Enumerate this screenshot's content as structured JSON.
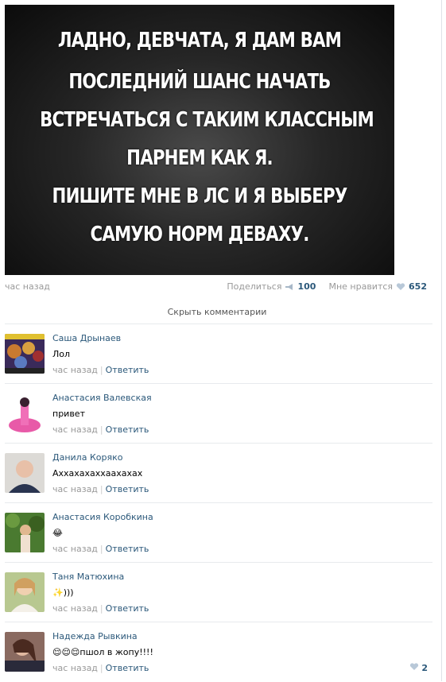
{
  "post": {
    "image_lines": [
      "ЛАДНО, ДЕВЧАТА, Я ДАМ ВАМ",
      "ПОСЛЕДНИЙ ШАНС НАЧАТЬ",
      "ВСТРЕЧАТЬСЯ С ТАКИМ КЛАССНЫМ",
      "ПАРНЕМ КАК Я.",
      "ПИШИТЕ МНЕ В ЛС И Я ВЫБЕРУ",
      "САМУЮ НОРМ ДЕВАХУ."
    ],
    "time": "час назад",
    "share_label": "Поделиться",
    "share_count": "100",
    "like_label": "Мне нравится",
    "like_count": "652",
    "hide_comments": "Скрыть комментарии"
  },
  "comments": [
    {
      "author": "Саша Дрынаев",
      "text": "Лол",
      "time": "час назад",
      "reply": "Ответить",
      "likes": ""
    },
    {
      "author": "Анастасия Валевская",
      "text": "привет",
      "time": "час назад",
      "reply": "Ответить",
      "likes": ""
    },
    {
      "author": "Данила Коряко",
      "text": "Аххахахаххаахахах",
      "time": "час назад",
      "reply": "Ответить",
      "likes": ""
    },
    {
      "author": "Анастасия Коробкина",
      "text": "😂",
      "time": "час назад",
      "reply": "Ответить",
      "likes": ""
    },
    {
      "author": "Таня Матюхина",
      "text": "✨)))",
      "time": "час назад",
      "reply": "Ответить",
      "likes": ""
    },
    {
      "author": "Надежда Рывкина",
      "text": "😌😌😌пшол в жопу!!!!",
      "time": "час назад",
      "reply": "Ответить",
      "likes": "2"
    }
  ],
  "colors": {
    "link": "#2b587a",
    "muted": "#999999",
    "separator": "#e7eaed"
  }
}
